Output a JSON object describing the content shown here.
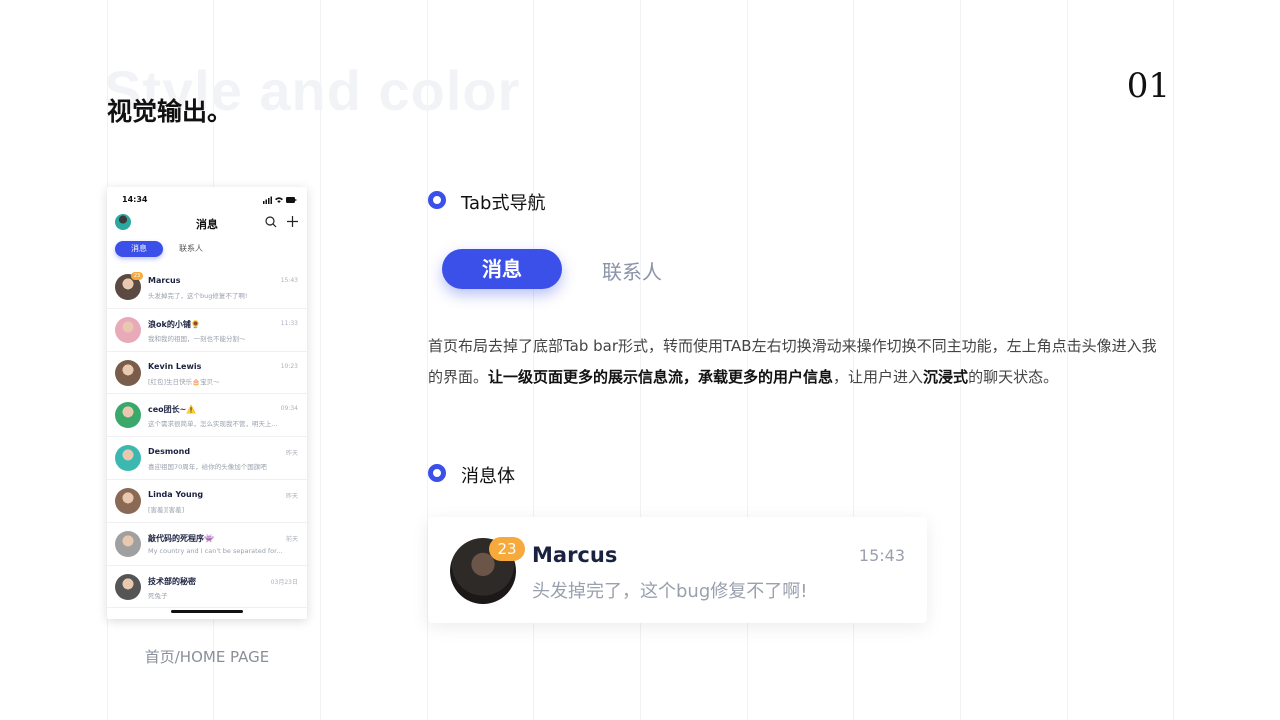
{
  "header": {
    "bg_title": "Style and color",
    "title": "视觉输出。",
    "page_number": "01"
  },
  "phone": {
    "status_time": "14:34",
    "nav_title": "消息",
    "tabs": {
      "active": "消息",
      "inactive": "联系人"
    },
    "conversations": [
      {
        "name": "Marcus",
        "message": "头发掉完了，这个bug修复不了啊!",
        "time": "15:43",
        "badge": "23",
        "avatar_color": "#5a4a42"
      },
      {
        "name": "浪ok的小铺🌻",
        "message": "我和我的祖国，一刻也不能分割～",
        "time": "11:33",
        "badge": "",
        "avatar_color": "#e8a9b8"
      },
      {
        "name": "Kevin Lewis",
        "message": "[红包]生日快乐🎂宝贝～",
        "time": "10:23",
        "badge": "",
        "avatar_color": "#7a5c4a"
      },
      {
        "name": "ceo团长~⚠️",
        "message": "这个需求很简单，怎么实现我不管，明天上...",
        "time": "09:34",
        "badge": "",
        "avatar_color": "#3aa86a"
      },
      {
        "name": "Desmond",
        "message": "喜迎祖国70周年，给你的头像加个国旗吧",
        "time": "昨天",
        "badge": "",
        "avatar_color": "#3bb8b0"
      },
      {
        "name": "Linda Young",
        "message": "[害羞][害羞]",
        "time": "昨天",
        "badge": "",
        "avatar_color": "#8a6a55"
      },
      {
        "name": "敲代码的死程序👾",
        "message": "My country and I can't be separated for...",
        "time": "前天",
        "badge": "",
        "avatar_color": "#a0a0a0"
      },
      {
        "name": "技术部的秘密",
        "message": "死兔子",
        "time": "03月23日",
        "badge": "",
        "avatar_color": "#555555"
      }
    ]
  },
  "phone_caption": "首页/HOME PAGE",
  "section1": {
    "title": "Tab式导航",
    "tab_active": "消息",
    "tab_inactive": "联系人"
  },
  "description": {
    "part1": "首页布局去掉了底部Tab bar形式，转而使用TAB左右切换滑动来操作切换不同主功能，左上角点击头像进入我的界面。",
    "bold1": "让一级页面更多的展示信息流，承载更多的用户信息",
    "part2": "，让用户进入",
    "bold2": "沉浸式",
    "part3": "的聊天状态。"
  },
  "section2": {
    "title": "消息体",
    "card": {
      "name": "Marcus",
      "message": "头发掉完了，这个bug修复不了啊!",
      "time": "15:43",
      "badge": "23"
    }
  },
  "colors": {
    "accent": "#3b50e8",
    "badge": "#f7a93b",
    "name_text": "#1b2240",
    "muted_text": "#9aa0ad"
  }
}
